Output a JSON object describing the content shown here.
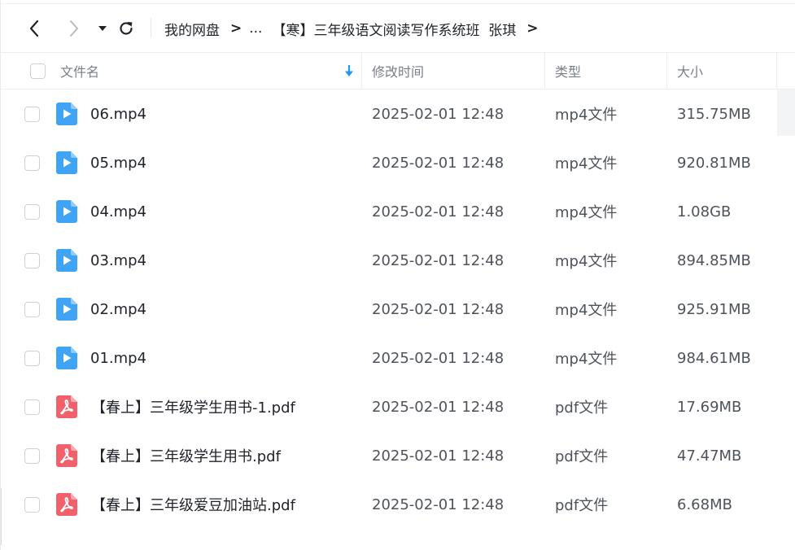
{
  "breadcrumb": {
    "root": "我的网盘",
    "ellipsis": "...",
    "folder": "【寒】三年级语文阅读写作系统班  张琪",
    "separator": ">"
  },
  "columns": {
    "name": "文件名",
    "modified": "修改时间",
    "type": "类型",
    "size": "大小"
  },
  "colors": {
    "video_icon": "#3fa4f5",
    "pdf_icon": "#f2606b",
    "sort_arrow": "#2196f3"
  },
  "files": [
    {
      "name": "06.mp4",
      "modified": "2025-02-01 12:48",
      "type": "mp4文件",
      "size": "315.75MB",
      "icon": "video-file-icon"
    },
    {
      "name": "05.mp4",
      "modified": "2025-02-01 12:48",
      "type": "mp4文件",
      "size": "920.81MB",
      "icon": "video-file-icon"
    },
    {
      "name": "04.mp4",
      "modified": "2025-02-01 12:48",
      "type": "mp4文件",
      "size": "1.08GB",
      "icon": "video-file-icon"
    },
    {
      "name": "03.mp4",
      "modified": "2025-02-01 12:48",
      "type": "mp4文件",
      "size": "894.85MB",
      "icon": "video-file-icon"
    },
    {
      "name": "02.mp4",
      "modified": "2025-02-01 12:48",
      "type": "mp4文件",
      "size": "925.91MB",
      "icon": "video-file-icon"
    },
    {
      "name": "01.mp4",
      "modified": "2025-02-01 12:48",
      "type": "mp4文件",
      "size": "984.61MB",
      "icon": "video-file-icon"
    },
    {
      "name": "【春上】三年级学生用书-1.pdf",
      "modified": "2025-02-01 12:48",
      "type": "pdf文件",
      "size": "17.69MB",
      "icon": "pdf-file-icon"
    },
    {
      "name": "【春上】三年级学生用书.pdf",
      "modified": "2025-02-01 12:48",
      "type": "pdf文件",
      "size": "47.47MB",
      "icon": "pdf-file-icon"
    },
    {
      "name": "【春上】三年级爱豆加油站.pdf",
      "modified": "2025-02-01 12:48",
      "type": "pdf文件",
      "size": "6.68MB",
      "icon": "pdf-file-icon"
    }
  ]
}
